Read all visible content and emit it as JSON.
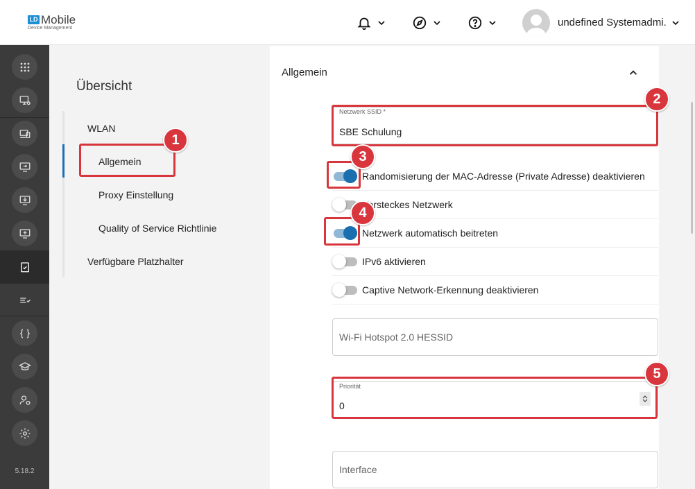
{
  "header": {
    "logo_badge": "LD",
    "logo_name": "Mobile",
    "logo_sub": "Device Management",
    "user_name": "undefined Systemadmi..."
  },
  "sidebar": {
    "version": "5.18.2",
    "icons": [
      "apps-grid-icon",
      "monitor-settings-icon",
      "devices-icon",
      "screen-arrow-icon",
      "download-icon",
      "add-screen-icon",
      "clipboard-check-icon",
      "list-check-icon",
      "braces-icon",
      "education-icon",
      "user-settings-icon",
      "gear-icon"
    ]
  },
  "overview": {
    "title": "Übersicht",
    "items": [
      {
        "label": "WLAN"
      },
      {
        "label": "Allgemein"
      },
      {
        "label": "Proxy Einstellung"
      },
      {
        "label": "Quality of Service Richtlinie"
      },
      {
        "label": "Verfügbare Platzhalter"
      }
    ]
  },
  "panel": {
    "title": "Allgemein",
    "ssid": {
      "label": "Netzwerk SSID *",
      "value": "SBE Schulung"
    },
    "toggles": [
      {
        "label": "Randomisierung der MAC-Adresse (Private Adresse) deaktivieren",
        "on": true
      },
      {
        "label": "Versteckes Netzwerk",
        "on": false
      },
      {
        "label": "Netzwerk automatisch beitreten",
        "on": true
      },
      {
        "label": "IPv6 aktivieren",
        "on": false
      },
      {
        "label": "Captive Network-Erkennung deaktivieren",
        "on": false
      }
    ],
    "hessid": {
      "placeholder": "Wi-Fi Hotspot 2.0 HESSID"
    },
    "priority": {
      "label": "Priorität",
      "value": "0"
    },
    "interface": {
      "placeholder": "Interface"
    }
  },
  "callouts": [
    "1",
    "2",
    "3",
    "4",
    "5"
  ],
  "colors": {
    "accent": "#1a6fae",
    "callout": "#d8353c",
    "sidebar": "#3b3b3b"
  }
}
